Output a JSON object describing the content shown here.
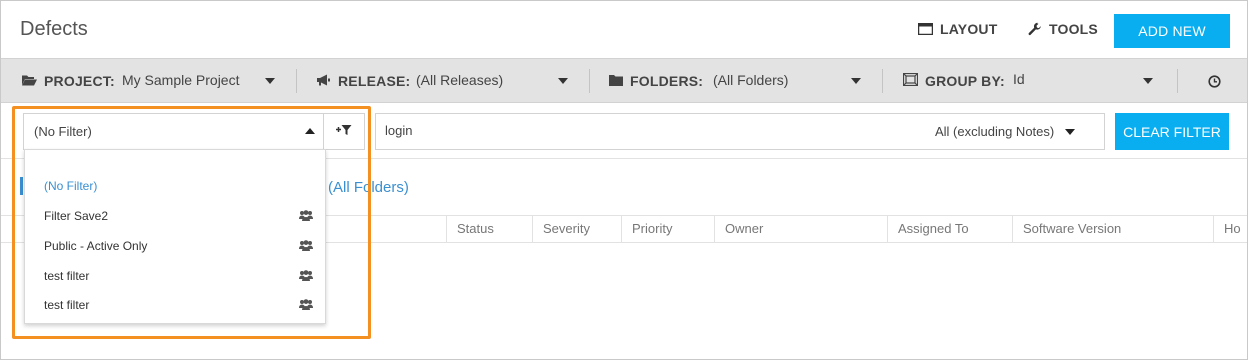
{
  "header": {
    "title": "Defects",
    "layout_label": "LAYOUT",
    "tools_label": "TOOLS",
    "add_new_label": "ADD NEW"
  },
  "toolbar": {
    "project_label": "PROJECT:",
    "project_value": "My Sample Project",
    "release_label": "RELEASE:",
    "release_value": "(All Releases)",
    "folders_label": "FOLDERS:",
    "folders_value": "(All Folders)",
    "groupby_label": "GROUP BY:",
    "groupby_value": "Id"
  },
  "filter": {
    "selected": "(No Filter)",
    "search_value": "login",
    "search_scope": "All (excluding Notes)",
    "clear_label": "CLEAR FILTER"
  },
  "dropdown": {
    "items": [
      {
        "label": "(No Filter)",
        "shared": false
      },
      {
        "label": "Filter Save2",
        "shared": true
      },
      {
        "label": "Public - Active Only",
        "shared": true
      },
      {
        "label": "test filter",
        "shared": true
      },
      {
        "label": "test filter",
        "shared": true
      }
    ]
  },
  "breadcrumb": {
    "folder": "(All Folders)"
  },
  "grid": {
    "columns": [
      "Status",
      "Severity",
      "Priority",
      "Owner",
      "Assigned To",
      "Software Version",
      "Ho"
    ]
  },
  "colors": {
    "accent": "#08aef0",
    "link": "#3a8fd1",
    "highlight": "#f39021"
  },
  "icons": {
    "layout": "layout-icon",
    "tools": "wrench-icon",
    "project": "folder-open-icon",
    "release": "megaphone-icon",
    "folders": "folder-icon",
    "groupby": "group-by-icon",
    "clock": "clock-icon",
    "add_filter": "add-filter-icon",
    "shared": "users-group-icon"
  }
}
